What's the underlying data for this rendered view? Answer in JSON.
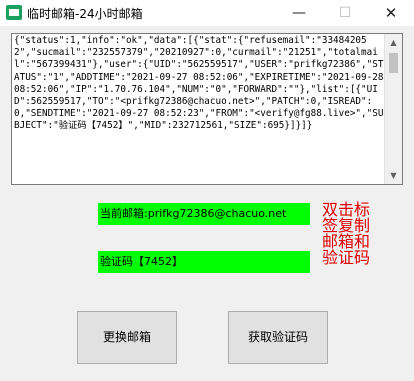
{
  "window": {
    "title": "临时邮箱-24小时邮箱",
    "min_glyph": "—",
    "max_glyph": "☐",
    "close_glyph": "✕"
  },
  "log": {
    "text": "{\"status\":1,\"info\":\"ok\",\"data\":[{\"stat\":{\"refusemail\":\"334842052\",\"sucmail\":\"232557379\",\"20210927\":0,\"curmail\":\"21251\",\"totalmail\":\"567399431\"},\"user\":{\"UID\":\"562559517\",\"USER\":\"prifkg72386\",\"STATUS\":\"1\",\"ADDTIME\":\"2021-09-27 08:52:06\",\"EXPIRETIME\":\"2021-09-28 08:52:06\",\"IP\":\"1.70.76.104\",\"NUM\":\"0\",\"FORWARD\":\"\"},\"list\":[{\"UID\":562559517,\"TO\":\"<prifkg72386@chacuo.net>\",\"PATCH\":0,\"ISREAD\":0,\"SENDTIME\":\"2021-09-27 08:52:23\",\"FROM\":\"<verify@fg88.live>\",\"SUBJECT\":\"验证码【7452】\",\"MID\":232712561,\"SIZE\":695}]}]}"
  },
  "fields": {
    "email": "当前邮箱:prifkg72386@chacuo.net",
    "code": "验证码【7452】"
  },
  "hint": "双击标签复制邮箱和验证码",
  "buttons": {
    "change": "更换邮箱",
    "get_code": "获取验证码"
  },
  "colors": {
    "field_bg": "#00ff00",
    "hint_text": "#e00000"
  }
}
